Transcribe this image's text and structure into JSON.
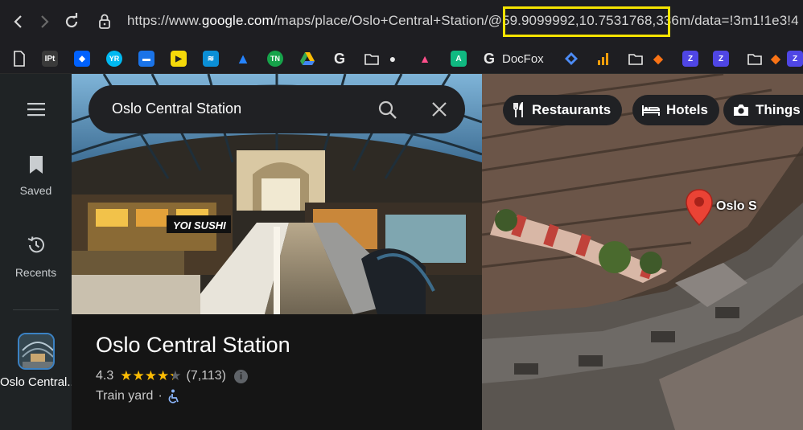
{
  "browser": {
    "url_prefix": "https://www.",
    "url_host": "google.com",
    "url_path_before": "/maps/place/Oslo+Central+Station/@",
    "url_coords": "59.9099992,10.7531768",
    "url_after": ",336m/data=!3m1!1e3!4"
  },
  "bookmarks": [
    {
      "label": "",
      "icon": "file-icon",
      "color": "#1e1e22"
    },
    {
      "label": "",
      "icon": "ipt-icon",
      "color": "#3a3a3a"
    },
    {
      "label": "",
      "icon": "dropbox-icon",
      "color": "#0061fe"
    },
    {
      "label": "",
      "icon": "yr-icon",
      "color": "#00b9f1"
    },
    {
      "label": "",
      "icon": "chat-icon",
      "color": "#1a73e8"
    },
    {
      "label": "",
      "icon": "play-icon",
      "color": "#f5d90a"
    },
    {
      "label": "",
      "icon": "router-icon",
      "color": "#0b8fd6"
    },
    {
      "label": "",
      "icon": "atlassian-icon",
      "color": "#1e1e22"
    },
    {
      "label": "",
      "icon": "tn-icon",
      "color": "#16a34a"
    },
    {
      "label": "",
      "icon": "drive-icon",
      "color": "#1e1e22"
    },
    {
      "label": "",
      "icon": "g-icon",
      "color": "#1e1e22"
    },
    {
      "label": "",
      "icon": "folder-icon",
      "color": "#1e1e22"
    },
    {
      "label": "",
      "icon": "speech-icon",
      "color": "#1e1e22"
    },
    {
      "label": "",
      "icon": "arc-icon",
      "color": "#1e1e22"
    },
    {
      "label": "",
      "icon": "a-icon",
      "color": "#10b981"
    },
    {
      "label": "DocFox",
      "icon": "docfox-icon",
      "color": "#1e1e22"
    },
    {
      "label": "",
      "icon": "diamond-icon",
      "color": "#1e1e22"
    },
    {
      "label": "",
      "icon": "bars-icon",
      "color": "#1e1e22"
    },
    {
      "label": "",
      "icon": "folder-icon",
      "color": "#1e1e22"
    },
    {
      "label": "",
      "icon": "fox-icon",
      "color": "#1e1e22"
    },
    {
      "label": "",
      "icon": "z-icon",
      "color": "#4f46e5"
    },
    {
      "label": "",
      "icon": "z2-icon",
      "color": "#4f46e5"
    },
    {
      "label": "",
      "icon": "folder-icon",
      "color": "#1e1e22"
    },
    {
      "label": "",
      "icon": "fox2-icon",
      "color": "#1e1e22"
    }
  ],
  "rail": {
    "saved": "Saved",
    "recents": "Recents",
    "place": "Oslo Central..."
  },
  "search": {
    "value": "Oslo Central Station"
  },
  "place": {
    "title": "Oslo Central Station",
    "rating": "4.3",
    "stars_filled": 4.3,
    "reviews": "(7,113)",
    "type": "Train yard",
    "separator": "·",
    "photo_sign": "YOI SUSHI"
  },
  "map": {
    "chips": [
      "Restaurants",
      "Hotels",
      "Things t"
    ],
    "pin_label": "Oslo S"
  },
  "colors": {
    "highlight": "#f5e400",
    "pin": "#ea4335",
    "star": "#fbbc04",
    "accessible": "#8ab4f8"
  }
}
